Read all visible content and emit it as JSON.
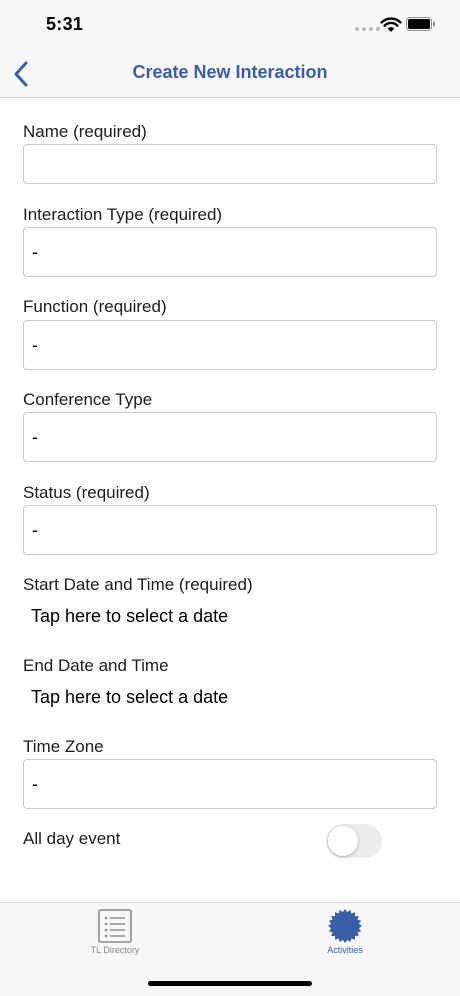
{
  "status_bar": {
    "time": "5:31"
  },
  "nav": {
    "title": "Create New Interaction"
  },
  "form": {
    "name_label": "Name (required)",
    "name_value": "",
    "interaction_type_label": "Interaction Type (required)",
    "interaction_type_value": "-",
    "function_label": "Function (required)",
    "function_value": "-",
    "conference_type_label": "Conference Type",
    "conference_type_value": "-",
    "status_label": "Status (required)",
    "status_value": "-",
    "start_label": "Start Date and Time (required)",
    "start_placeholder": "Tap here to select a date",
    "end_label": "End Date and Time",
    "end_placeholder": "Tap here to select a date",
    "timezone_label": "Time Zone",
    "timezone_value": "-",
    "all_day_label": "All day event",
    "all_day_on": false
  },
  "tabs": [
    {
      "label": "TL Directory",
      "icon": "list-icon",
      "active": false
    },
    {
      "label": "Activities",
      "icon": "gear-badge-icon",
      "active": true
    }
  ],
  "colors": {
    "accent": "#3a5da8",
    "border": "#c8c8cc",
    "bar_bg": "#f7f7f8"
  }
}
